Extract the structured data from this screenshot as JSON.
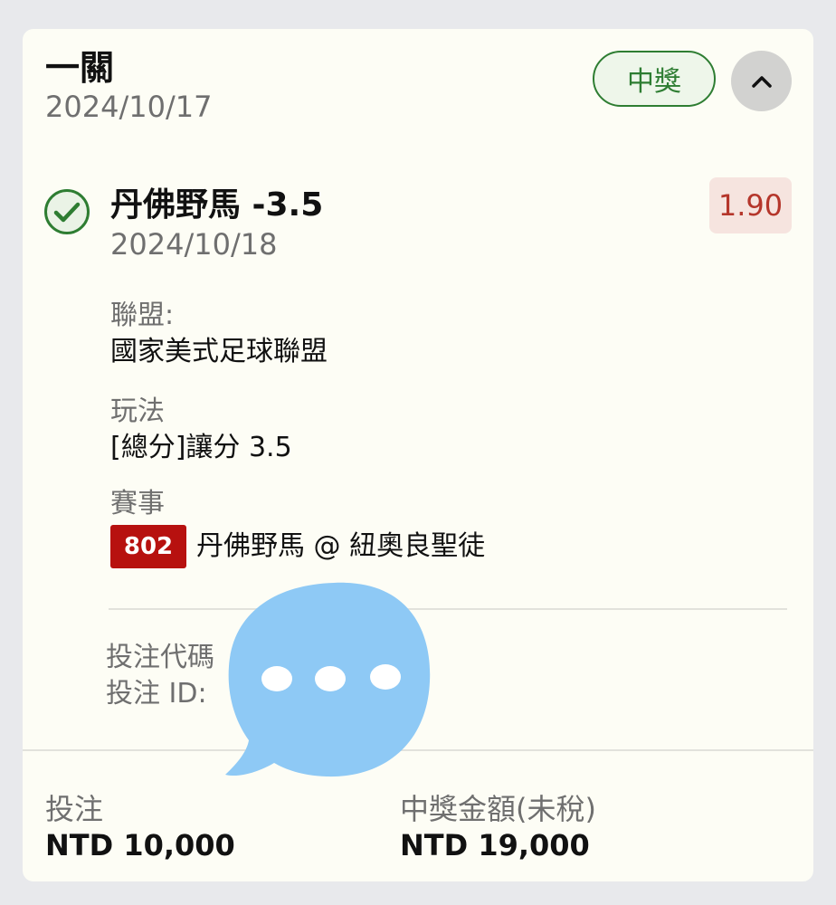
{
  "header": {
    "title": "一關",
    "date": "2024/10/17",
    "status": "中獎"
  },
  "pick": {
    "title": "丹佛野馬 -3.5",
    "date": "2024/10/18",
    "odds": "1.90"
  },
  "details": {
    "league_label": "聯盟:",
    "league_value": "國家美式足球聯盟",
    "play_label": "玩法",
    "play_value": "[總分]讓分 3.5",
    "event_label": "賽事",
    "event_number": "802",
    "event_value": "丹佛野馬 @ 紐奧良聖徒"
  },
  "codes": {
    "bet_code_label": "投注代碼",
    "bet_id_label": "投注 ID:"
  },
  "footer": {
    "stake_label": "投注",
    "stake_value": "NTD 10,000",
    "payout_label": "中獎金額(未稅)",
    "payout_value": "NTD 19,000"
  },
  "colors": {
    "win_green": "#2e7d32",
    "odds_red": "#b5362b",
    "event_badge_red": "#b7110f",
    "overlay_blue": "#8ec9f5"
  },
  "icons": [
    "check-circle-icon",
    "chevron-up-icon",
    "chat-bubble-icon"
  ]
}
